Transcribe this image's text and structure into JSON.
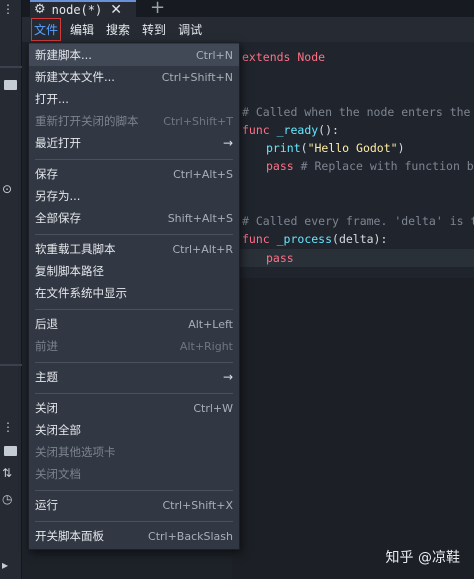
{
  "tab": {
    "title": "node(*)",
    "icon": "gear-icon",
    "close": "✕",
    "new": "+"
  },
  "menubar": {
    "items": [
      "文件",
      "编辑",
      "搜索",
      "转到",
      "调试"
    ]
  },
  "code": {
    "l1": "extends Node",
    "l2": "# Called when the node enters the",
    "l3a": "func ",
    "l3b": "_ready",
    "l3c": "():",
    "l4a": "print",
    "l4b": "(",
    "l4c": "\"Hello Godot\"",
    "l4d": ")",
    "l5a": "pass",
    "l5b": " # Replace with function b",
    "l6": "# Called every frame. 'delta' is t",
    "l7a": "func ",
    "l7b": "_process",
    "l7c": "(delta):",
    "l8": "pass"
  },
  "menu": {
    "items": [
      {
        "label": "新建脚本...",
        "shortcut": "Ctrl+N"
      },
      {
        "label": "新建文本文件...",
        "shortcut": "Ctrl+Shift+N"
      },
      {
        "label": "打开...",
        "shortcut": ""
      },
      {
        "label": "重新打开关闭的脚本",
        "shortcut": "Ctrl+Shift+T"
      },
      {
        "label": "最近打开",
        "shortcut": "→"
      },
      {
        "label": "保存",
        "shortcut": "Ctrl+Alt+S"
      },
      {
        "label": "另存为...",
        "shortcut": ""
      },
      {
        "label": "全部保存",
        "shortcut": "Shift+Alt+S"
      },
      {
        "label": "软重载工具脚本",
        "shortcut": "Ctrl+Alt+R"
      },
      {
        "label": "复制脚本路径",
        "shortcut": ""
      },
      {
        "label": "在文件系统中显示",
        "shortcut": ""
      },
      {
        "label": "后退",
        "shortcut": "Alt+Left"
      },
      {
        "label": "前进",
        "shortcut": "Alt+Right"
      },
      {
        "label": "主题",
        "shortcut": "→"
      },
      {
        "label": "关闭",
        "shortcut": "Ctrl+W"
      },
      {
        "label": "关闭全部",
        "shortcut": ""
      },
      {
        "label": "关闭其他选项卡",
        "shortcut": ""
      },
      {
        "label": "关闭文档",
        "shortcut": ""
      },
      {
        "label": "运行",
        "shortcut": "Ctrl+Shift+X"
      },
      {
        "label": "开关脚本面板",
        "shortcut": "Ctrl+BackSlash"
      }
    ]
  },
  "watermark": "知乎 @凉鞋"
}
